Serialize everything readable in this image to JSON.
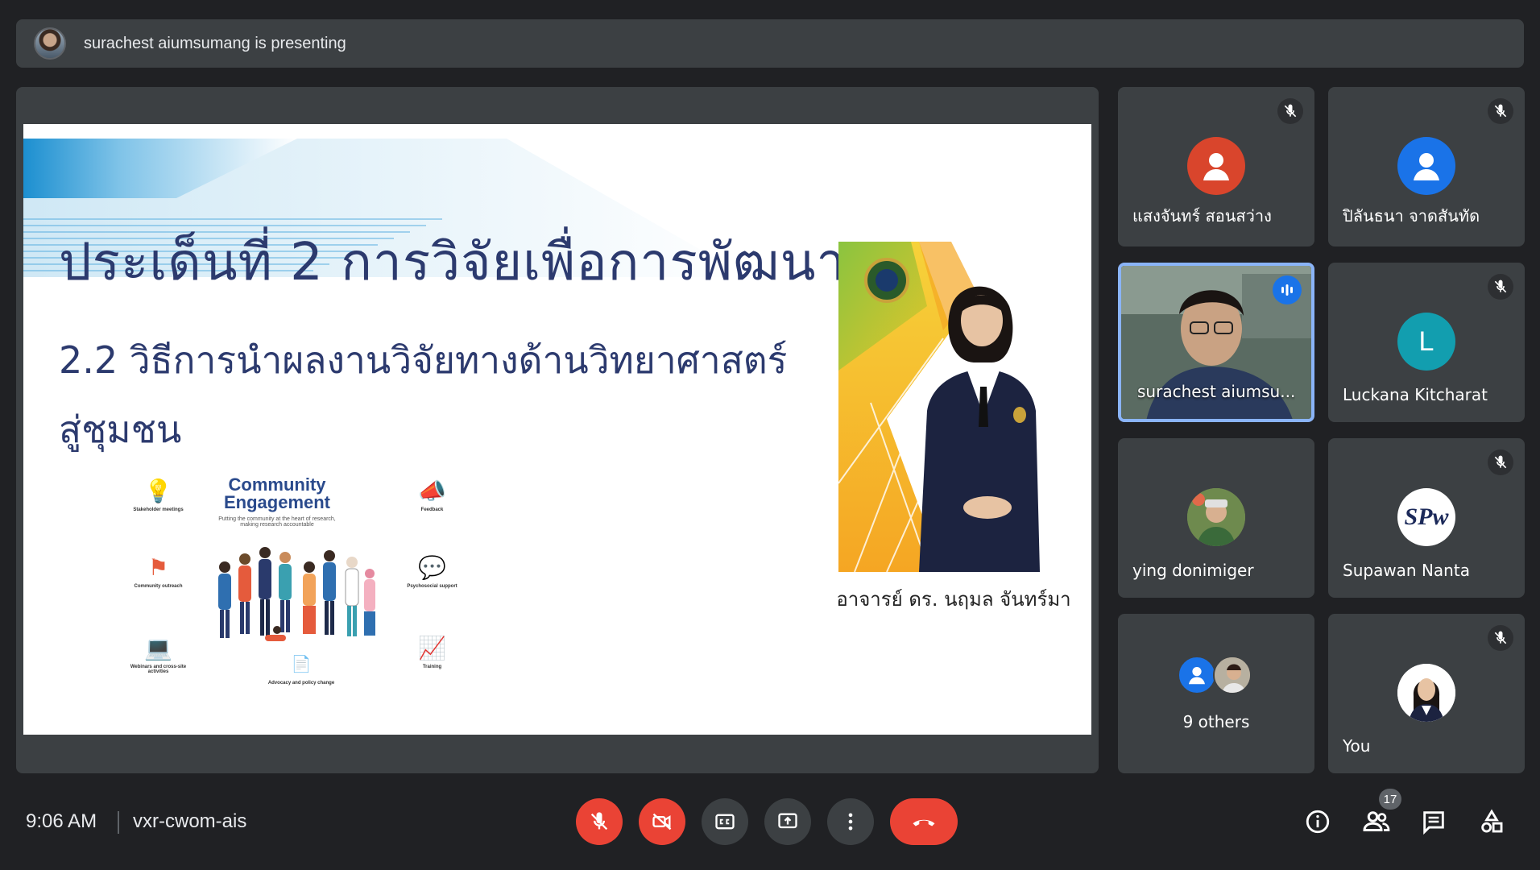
{
  "banner": {
    "text": "surachest aiumsumang is presenting"
  },
  "slide": {
    "title": "ประเด็นที่ 2  การวิจัยเพื่อการพัฒนา",
    "subtitle_line1": "2.2  วิธีการนำผลงานวิจัยทางด้านวิทยาศาสตร์",
    "subtitle_line2": "สู่ชุมชน",
    "presenter_name": "อาจารย์ ดร. นฤมล จันทร์มา",
    "infographic": {
      "title_line1": "Community",
      "title_line2": "Engagement",
      "caption": "Putting the community at the heart of research, making research accountable",
      "items": [
        {
          "label": "Stakeholder meetings",
          "icon": "lightbulb-icon"
        },
        {
          "label": "Feedback",
          "icon": "megaphone-icon"
        },
        {
          "label": "Community outreach",
          "icon": "flag-icon"
        },
        {
          "label": "Psychosocial support",
          "icon": "chat-bubble-icon"
        },
        {
          "label": "Webinars and cross-site activities",
          "icon": "laptop-icon"
        },
        {
          "label": "Advocacy and policy change",
          "icon": "document-icon"
        },
        {
          "label": "Training",
          "icon": "presentation-board-icon"
        }
      ]
    }
  },
  "participants": [
    {
      "name": "แสงจันทร์ สอนสว่าง",
      "avatar_type": "person-icon",
      "avatar_color": "#d9452c",
      "muted": true
    },
    {
      "name": "ปิลันธนา จาดสันทัด",
      "avatar_type": "person-icon",
      "avatar_color": "#1a73e8",
      "muted": true
    },
    {
      "name": "surachest aiumsu...",
      "avatar_type": "video",
      "muted": false,
      "speaking": true
    },
    {
      "name": "Luckana Kitcharat",
      "avatar_type": "letter",
      "letter": "L",
      "avatar_color": "#129eaf",
      "muted": true
    },
    {
      "name": "ying donimiger",
      "avatar_type": "photo",
      "muted": false
    },
    {
      "name": "Supawan Nanta",
      "avatar_type": "logo",
      "logo_text": "SPw",
      "muted": true
    },
    {
      "name": "9 others",
      "avatar_type": "group",
      "muted": false
    },
    {
      "name": "You",
      "avatar_type": "photo",
      "muted": true
    }
  ],
  "bottom_bar": {
    "time": "9:06 AM",
    "meeting_code": "vxr-cwom-ais",
    "participant_count": "17"
  },
  "colors": {
    "background": "#202124",
    "tile": "#3c4043",
    "danger": "#ea4335",
    "active_border": "#8ab4f8"
  }
}
